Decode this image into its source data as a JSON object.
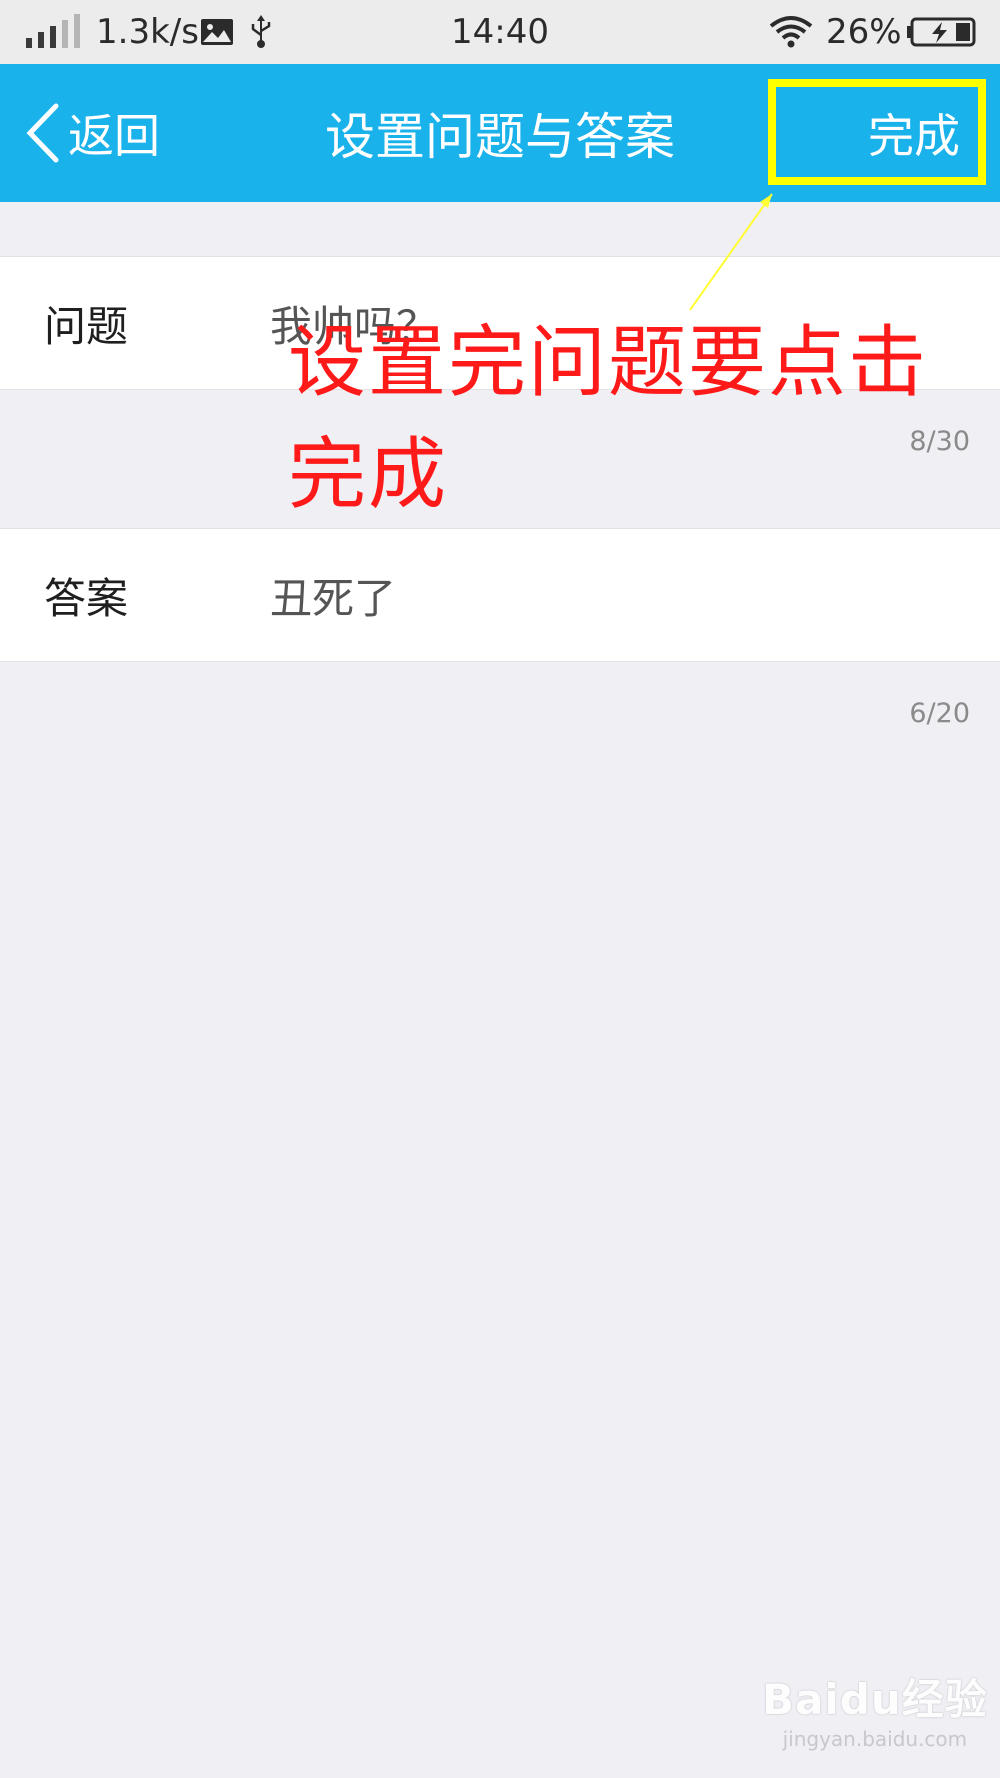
{
  "status_bar": {
    "network_speed": "1.3k/s",
    "time": "14:40",
    "battery_percent": "26%",
    "icons": [
      "signal-icon",
      "image-icon",
      "usb-icon",
      "wifi-icon",
      "battery-charging-icon"
    ]
  },
  "nav": {
    "back_label": "返回",
    "title": "设置问题与答案",
    "done_label": "完成",
    "bar_color": "#1ab2ea"
  },
  "question": {
    "label": "问题",
    "value": "我帅吗？",
    "counter": "8/30"
  },
  "answer": {
    "label": "答案",
    "value": "丑死了",
    "counter": "6/20"
  },
  "annotation": {
    "text": "设置完问题要点击完成",
    "text_color": "#ff1a1a",
    "highlight_color": "#ffff00"
  },
  "watermark": {
    "main": "Baidu经验",
    "sub": "jingyan.baidu.com"
  }
}
